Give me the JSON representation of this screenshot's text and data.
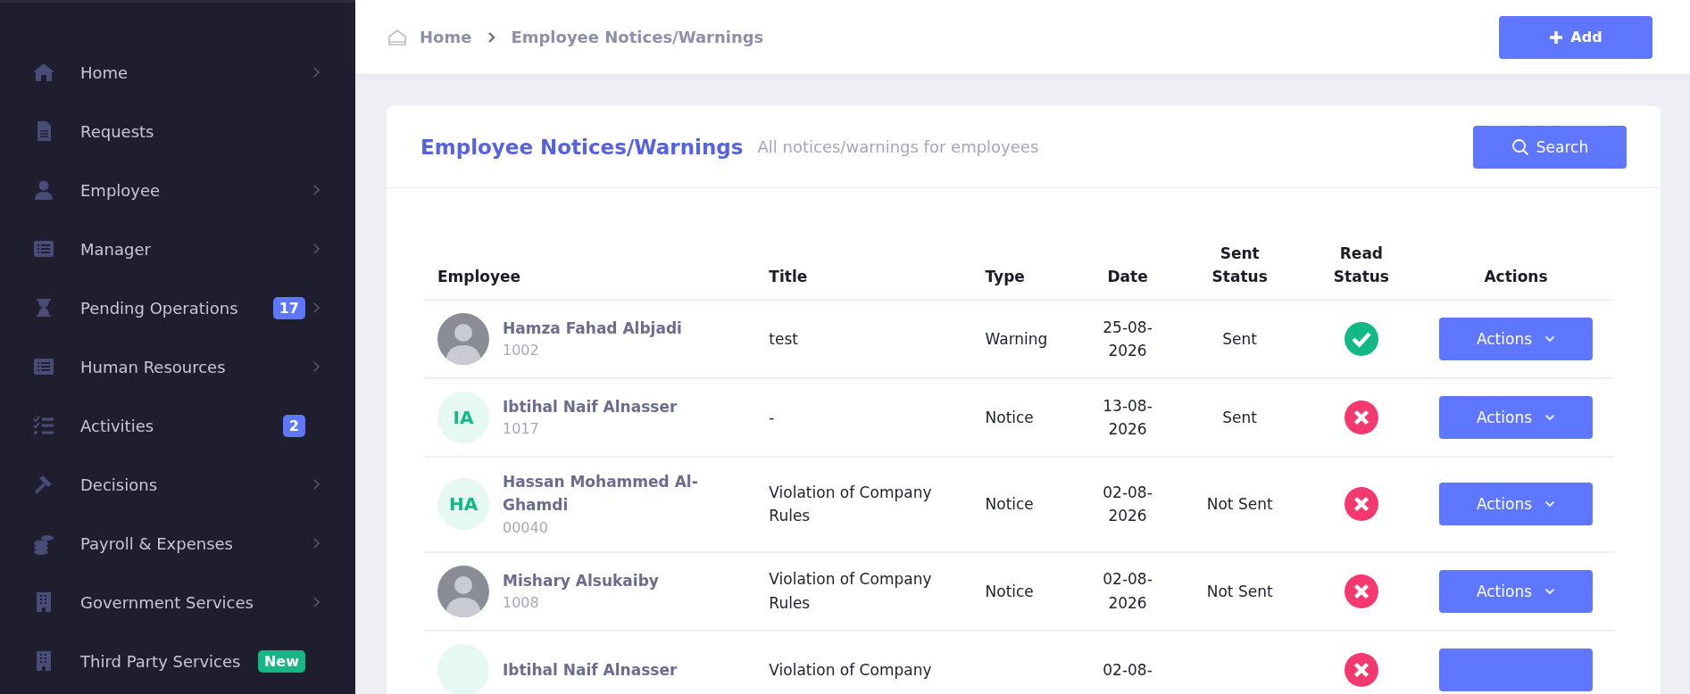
{
  "sidebar": {
    "items": [
      {
        "label": "Home",
        "has_submenu": true
      },
      {
        "label": "Requests",
        "has_submenu": false
      },
      {
        "label": "Employee",
        "has_submenu": true
      },
      {
        "label": "Manager",
        "has_submenu": true
      },
      {
        "label": "Pending Operations",
        "has_submenu": true,
        "badge": {
          "text": "17",
          "kind": "count"
        }
      },
      {
        "label": "Human Resources",
        "has_submenu": true
      },
      {
        "label": "Activities",
        "has_submenu": false,
        "badge": {
          "text": "2",
          "kind": "count"
        }
      },
      {
        "label": "Decisions",
        "has_submenu": true
      },
      {
        "label": "Payroll & Expenses",
        "has_submenu": true
      },
      {
        "label": "Government Services",
        "has_submenu": true
      },
      {
        "label": "Third Party Services",
        "has_submenu": false,
        "badge": {
          "text": "New",
          "kind": "new"
        }
      }
    ]
  },
  "breadcrumb": [
    "Home",
    "Employee Notices/Warnings"
  ],
  "add_button": "Add",
  "card": {
    "title": "Employee Notices/Warnings",
    "subtitle": "All notices/warnings for employees",
    "search_button": "Search"
  },
  "table": {
    "columns": [
      "Employee",
      "Title",
      "Type",
      "Date",
      "Sent Status",
      "Read Status",
      "Actions"
    ],
    "rows": [
      {
        "name": "Hamza Fahad Albjadi",
        "id": "1002",
        "avatar": {
          "kind": "photo"
        },
        "title": "test",
        "type": "Warning",
        "date": "25-08-2026",
        "sent_status": "Sent",
        "read": true,
        "action": "Actions"
      },
      {
        "name": "Ibtihal Naif Alnasser",
        "id": "1017",
        "avatar": {
          "kind": "initials",
          "text": "IA"
        },
        "title": "-",
        "type": "Notice",
        "date": "13-08-2026",
        "sent_status": "Sent",
        "read": false,
        "action": "Actions"
      },
      {
        "name": "Hassan Mohammed Al-Ghamdi",
        "id": "00040",
        "avatar": {
          "kind": "initials",
          "text": "HA"
        },
        "title": "Violation of Company Rules",
        "type": "Notice",
        "date": "02-08-2026",
        "sent_status": "Not Sent",
        "read": false,
        "action": "Actions"
      },
      {
        "name": "Mishary Alsukaiby",
        "id": "1008",
        "avatar": {
          "kind": "photo"
        },
        "title": "Violation of Company Rules",
        "type": "Notice",
        "date": "02-08-2026",
        "sent_status": "Not Sent",
        "read": false,
        "action": "Actions"
      },
      {
        "name": "Ibtihal Naif Alnasser",
        "avatar": {
          "kind": "initials"
        },
        "title": "Violation of Company",
        "date": "02-08-",
        "read": false
      }
    ]
  }
}
